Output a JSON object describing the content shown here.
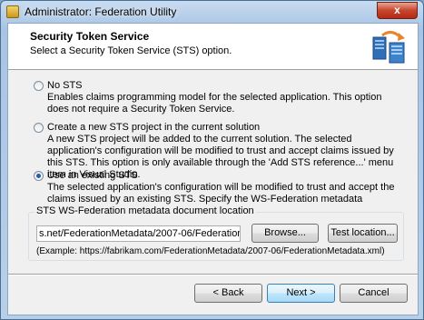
{
  "window": {
    "title": "Administrator: Federation Utility",
    "close_label": "x"
  },
  "header": {
    "title": "Security Token Service",
    "subtitle": "Select a Security Token Service (STS) option."
  },
  "options": [
    {
      "label": "No STS",
      "description": "Enables claims programming model for the selected application. This option does not require a Security Token Service.",
      "checked": false
    },
    {
      "label": "Create a new STS project in the current solution",
      "description": "A new STS project will be added to the current solution. The selected application's configuration will be modified to trust and accept claims issued by this STS. This option is only available through the 'Add STS reference...' menu item in Visual Studio.",
      "checked": false
    },
    {
      "label": "Use an existing STS",
      "description": "The selected application's configuration will be modified to trust and accept the claims issued by an existing STS. Specify the WS-Federation metadata document location for the existing STS.",
      "checked": true
    }
  ],
  "metadata": {
    "group_label": "STS WS-Federation metadata document location",
    "value": "s.net/FederationMetadata/2007-06/FederationMetadata.xml",
    "browse_label": "Browse...",
    "test_label": "Test location...",
    "example": "(Example: https://fabrikam.com/FederationMetadata/2007-06/FederationMetadata.xml)"
  },
  "footer": {
    "back_label": "< Back",
    "next_label": "Next >",
    "cancel_label": "Cancel"
  }
}
